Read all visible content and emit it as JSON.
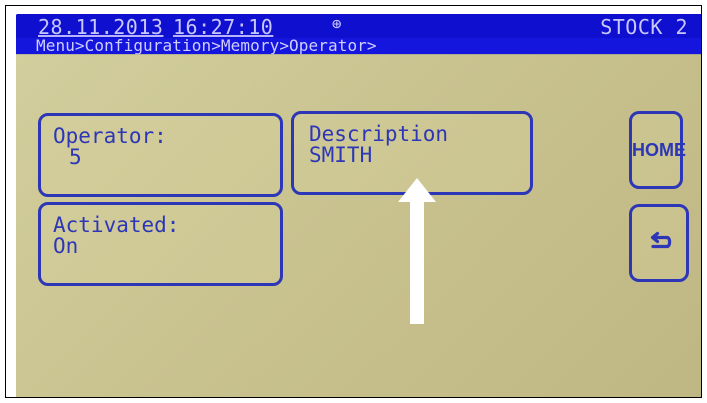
{
  "status": {
    "date": "28.11.2013",
    "time": "16:27:10",
    "stock": "STOCK 2"
  },
  "breadcrumb": "Menu>Configuration>Memory>Operator>",
  "fields": {
    "operator": {
      "label": "Operator:",
      "value": "5"
    },
    "description": {
      "label": "Description",
      "value": "SMITH"
    },
    "activated": {
      "label": "Activated:",
      "value": "On"
    }
  },
  "buttons": {
    "home": "HOME"
  },
  "icons": {
    "status_icon": "connector-icon",
    "back_icon": "back-arrow-icon"
  },
  "colors": {
    "screen_background": "#c9c390",
    "header_blue": "#0f0fcf",
    "text_blue": "#2d36b7",
    "annotation_arrow": "#ffffff"
  }
}
